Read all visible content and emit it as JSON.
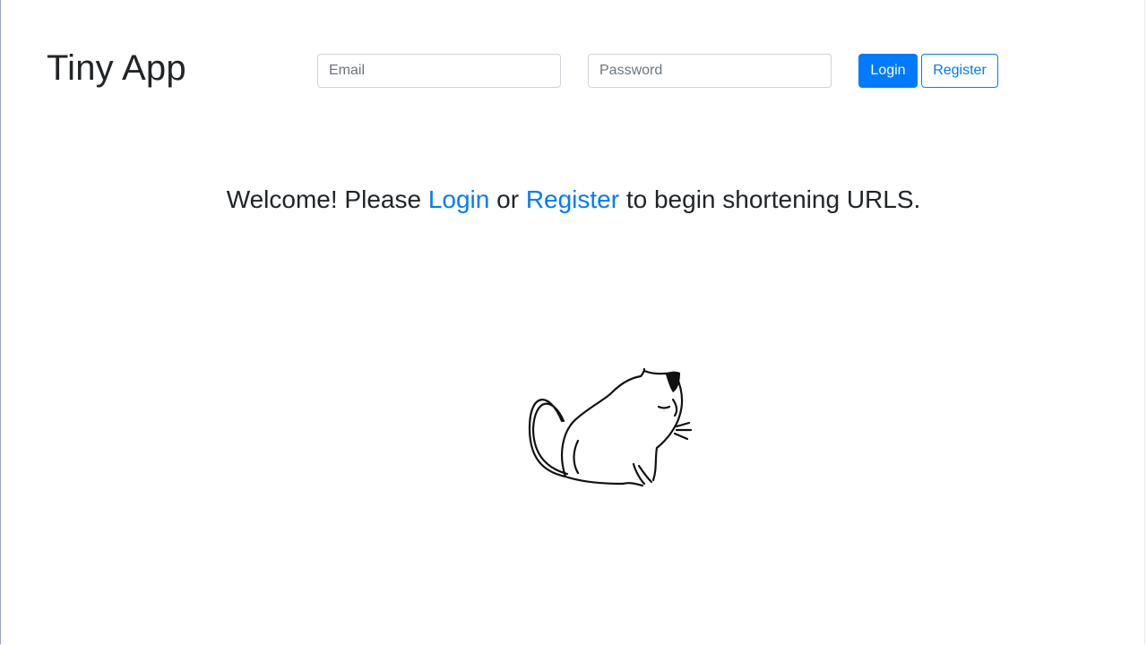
{
  "header": {
    "brand": "Tiny App",
    "email_placeholder": "Email",
    "password_placeholder": "Password",
    "login_label": "Login",
    "register_label": "Register"
  },
  "main": {
    "welcome_prefix": "Welcome! Please ",
    "login_link": "Login",
    "welcome_middle": " or ",
    "register_link": "Register",
    "welcome_suffix": " to begin shortening URLS."
  },
  "illustration": {
    "icon": "cat-sketch-icon"
  },
  "colors": {
    "primary": "#007bff",
    "text": "#212529"
  }
}
